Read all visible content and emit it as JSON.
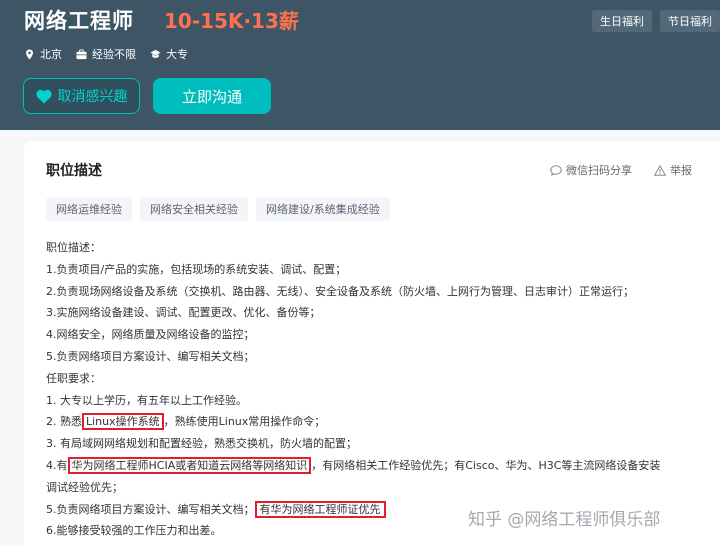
{
  "header": {
    "job_title": "网络工程师",
    "salary": "10-15K·13薪",
    "perks": [
      "生日福利",
      "节日福利"
    ],
    "meta": {
      "location": "北京",
      "experience": "经验不限",
      "education": "大专"
    },
    "buttons": {
      "uninterest": "取消感兴趣",
      "chat": "立即沟通"
    }
  },
  "card": {
    "title": "职位描述",
    "share": "微信扫码分享",
    "report": "举报",
    "tags": [
      "网络运维经验",
      "网络安全相关经验",
      "网络建设/系统集成经验"
    ],
    "desc": {
      "l1": "职位描述：",
      "l2": "1.负责项目/产品的实施，包括现场的系统安装、调试、配置；",
      "l3": "2.负责现场网络设备及系统（交换机、路由器、无线）、安全设备及系统（防火墙、上网行为管理、日志审计）正常运行；",
      "l4": "3.实施网络设备建设、调试、配置更改、优化、备份等；",
      "l5": "4.网络安全，网络质量及网络设备的监控；",
      "l6": "5.负责网络项目方案设计、编写相关文档；",
      "l7": "任职要求：",
      "l8": "1. 大专以上学历，有五年以上工作经验。",
      "l9a": "2. 熟悉",
      "l9b": "Linux操作系统",
      "l9c": "，熟练使用Linux常用操作命令；",
      "l10": "3. 有局域网网络规划和配置经验，熟悉交换机，防火墙的配置；",
      "l11a": "4.有",
      "l11b": "华为网络工程师HCIA或者知道云网络等网络知识",
      "l11c": "，有网络相关工作经验优先；有Cisco、华为、H3C等主流网络设备安装",
      "l12": "调试经验优先；",
      "l13a": "5.负责网络项目方案设计、编写相关文档；",
      "l13b": "有华为网络工程师证优先",
      "l14": "6.能够接受较强的工作压力和出差。"
    }
  },
  "watermark": "知乎 @网络工程师俱乐部",
  "colors": {
    "header_bg": "#3e5566",
    "salary": "#ff7150",
    "accent": "#00bebd",
    "highlight_border": "#e0202a"
  }
}
